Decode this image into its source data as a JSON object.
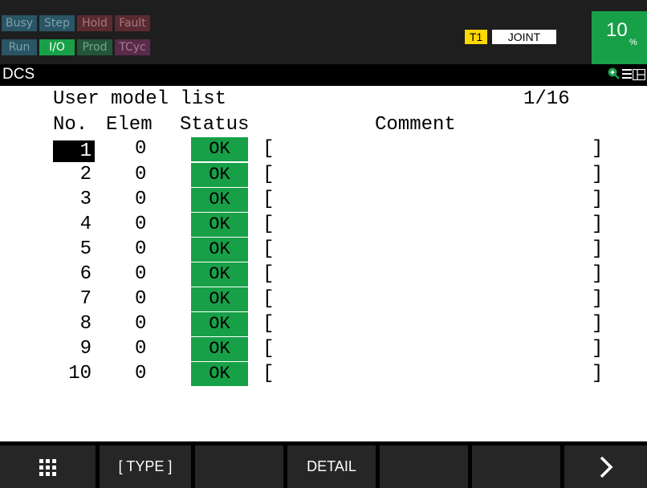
{
  "status": {
    "row1": [
      "Busy",
      "Step",
      "Hold",
      "Fault"
    ],
    "row2": [
      "Run",
      "I/O",
      "Prod",
      "TCyc"
    ],
    "mode": "T1",
    "coord": "JOINT",
    "override_value": "10",
    "override_unit": "%"
  },
  "titlebar": {
    "screen_name": "DCS"
  },
  "list": {
    "title": "User model list",
    "page": "1/16",
    "headers": {
      "no": "No.",
      "elem": "Elem",
      "status": "Status",
      "comment": "Comment"
    },
    "rows": [
      {
        "no": "1",
        "elem": "0",
        "status": "OK",
        "comment_open": "[",
        "comment_close": "]"
      },
      {
        "no": "2",
        "elem": "0",
        "status": "OK",
        "comment_open": "[",
        "comment_close": "]"
      },
      {
        "no": "3",
        "elem": "0",
        "status": "OK",
        "comment_open": "[",
        "comment_close": "]"
      },
      {
        "no": "4",
        "elem": "0",
        "status": "OK",
        "comment_open": "[",
        "comment_close": "]"
      },
      {
        "no": "5",
        "elem": "0",
        "status": "OK",
        "comment_open": "[",
        "comment_close": "]"
      },
      {
        "no": "6",
        "elem": "0",
        "status": "OK",
        "comment_open": "[",
        "comment_close": "]"
      },
      {
        "no": "7",
        "elem": "0",
        "status": "OK",
        "comment_open": "[",
        "comment_close": "]"
      },
      {
        "no": "8",
        "elem": "0",
        "status": "OK",
        "comment_open": "[",
        "comment_close": "]"
      },
      {
        "no": "9",
        "elem": "0",
        "status": "OK",
        "comment_open": "[",
        "comment_close": "]"
      },
      {
        "no": "10",
        "elem": "0",
        "status": "OK",
        "comment_open": "[",
        "comment_close": "]"
      }
    ]
  },
  "fkeys": {
    "menu_icon": "grid-icon",
    "f1": "[ TYPE ]",
    "f2": "",
    "f3": "DETAIL",
    "f4": "",
    "f5": "",
    "next_icon": "chevron-right-icon"
  },
  "colors": {
    "ok_green": "#18a048",
    "mode_yellow": "#ffd800",
    "dark_bg": "#1e1e1e"
  }
}
